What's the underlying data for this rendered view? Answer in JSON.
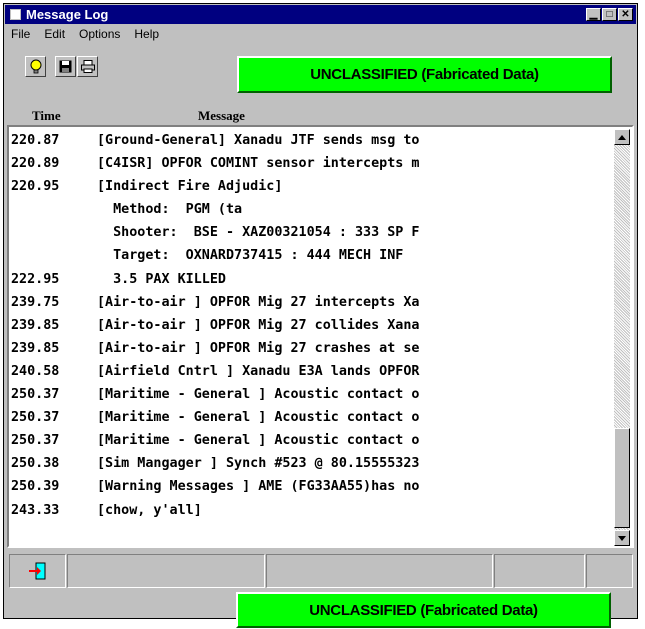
{
  "window": {
    "title": "Message Log",
    "caption_buttons": {
      "minimize": "▁",
      "maximize": "□",
      "close": "✕"
    }
  },
  "menu": [
    "File",
    "Edit",
    "Options",
    "Help"
  ],
  "toolbar": {
    "buttons": [
      {
        "name": "lightbulb-icon"
      },
      {
        "name": "save-icon"
      },
      {
        "name": "print-icon"
      }
    ]
  },
  "banner_text": "UNCLASSIFIED (Fabricated Data)",
  "banner_color": "#00ff00",
  "columns": {
    "time": "Time",
    "message": "Message"
  },
  "log_rows": [
    {
      "time": "220.87",
      "message": "[Ground-General] Xanadu JTF sends msg to"
    },
    {
      "time": "220.89",
      "message": "[C4ISR] OPFOR COMINT sensor intercepts m"
    },
    {
      "time": "220.95",
      "message": "[Indirect Fire Adjudic]"
    },
    {
      "time": "",
      "message": "  Method:  PGM (ta"
    },
    {
      "time": "",
      "message": "  Shooter:  BSE - XAZ00321054 : 333 SP F"
    },
    {
      "time": "",
      "message": "  Target:  OXNARD737415 : 444 MECH INF"
    },
    {
      "time": "222.95",
      "message": "  3.5 PAX KILLED"
    },
    {
      "time": "239.75",
      "message": "[Air-to-air ] OPFOR Mig 27 intercepts Xa"
    },
    {
      "time": "239.85",
      "message": "[Air-to-air ] OPFOR Mig 27 collides Xana"
    },
    {
      "time": "239.85",
      "message": "[Air-to-air ] OPFOR Mig 27 crashes at se"
    },
    {
      "time": "240.58",
      "message": "[Airfield Cntrl ] Xanadu E3A lands OPFOR"
    },
    {
      "time": "250.37",
      "message": "[Maritime - General ] Acoustic contact o"
    },
    {
      "time": "250.37",
      "message": "[Maritime - General ] Acoustic contact o"
    },
    {
      "time": "250.37",
      "message": "[Maritime - General ] Acoustic contact o"
    },
    {
      "time": "250.38",
      "message": "[Sim Mangager ] Synch #523 @ 80.15555323"
    },
    {
      "time": "250.39",
      "message": "[Warning Messages ] AME (FG33AA55)has no"
    },
    {
      "time": "243.33",
      "message": "[chow, y'all]"
    }
  ],
  "statusbar": {
    "icon": "exit-door-icon"
  }
}
